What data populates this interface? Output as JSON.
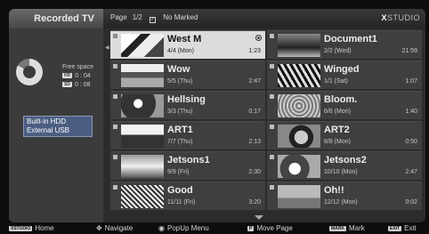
{
  "sidebar": {
    "title": "Recorded TV",
    "free_space_label": "Free space",
    "hd_tag": "HD",
    "hd_value": "0 : 04",
    "sd_tag": "SD",
    "sd_value": "0 : 08",
    "sources": [
      "Built-in HDD",
      "External USB"
    ]
  },
  "header": {
    "page_label": "Page",
    "page_value": "1/2",
    "marked_label": "No Marked",
    "brand_prefix": "X",
    "brand_rest": "STUDIO"
  },
  "recordings": [
    {
      "title": "West M",
      "date": "4/4 (Mon)",
      "duration": "1:23",
      "selected": true
    },
    {
      "title": "Document1",
      "date": "2/2 (Wed)",
      "duration": "21:59"
    },
    {
      "title": "Wow",
      "date": "5/5 (Thu)",
      "duration": "2:47"
    },
    {
      "title": "Winged",
      "date": "1/1 (Sat)",
      "duration": "1:07"
    },
    {
      "title": "Hellsing",
      "date": "3/3 (Thu)",
      "duration": "0:17"
    },
    {
      "title": "Bloom.",
      "date": "6/6 (Mon)",
      "duration": "1:40"
    },
    {
      "title": "ART1",
      "date": "7/7 (Thu)",
      "duration": "2:13"
    },
    {
      "title": "ART2",
      "date": "8/8 (Mon)",
      "duration": "0:50"
    },
    {
      "title": "Jetsons1",
      "date": "9/9 (Fri)",
      "duration": "2:30"
    },
    {
      "title": "Jetsons2",
      "date": "10/10 (Mon)",
      "duration": "2:47"
    },
    {
      "title": "Good",
      "date": "11/11 (Fri)",
      "duration": "3:20"
    },
    {
      "title": "Oh!!",
      "date": "12/12 (Mon)",
      "duration": "0:02"
    }
  ],
  "legend": {
    "home_key": "XSTUDIO",
    "home_label": "Home",
    "navigate_label": "Navigate",
    "popup_label": "PopUp Menu",
    "movepage_key": "P",
    "movepage_label": "Move Page",
    "mark_key": "MARK",
    "mark_label": "Mark",
    "exit_key": "EXIT",
    "exit_label": "Exit"
  }
}
